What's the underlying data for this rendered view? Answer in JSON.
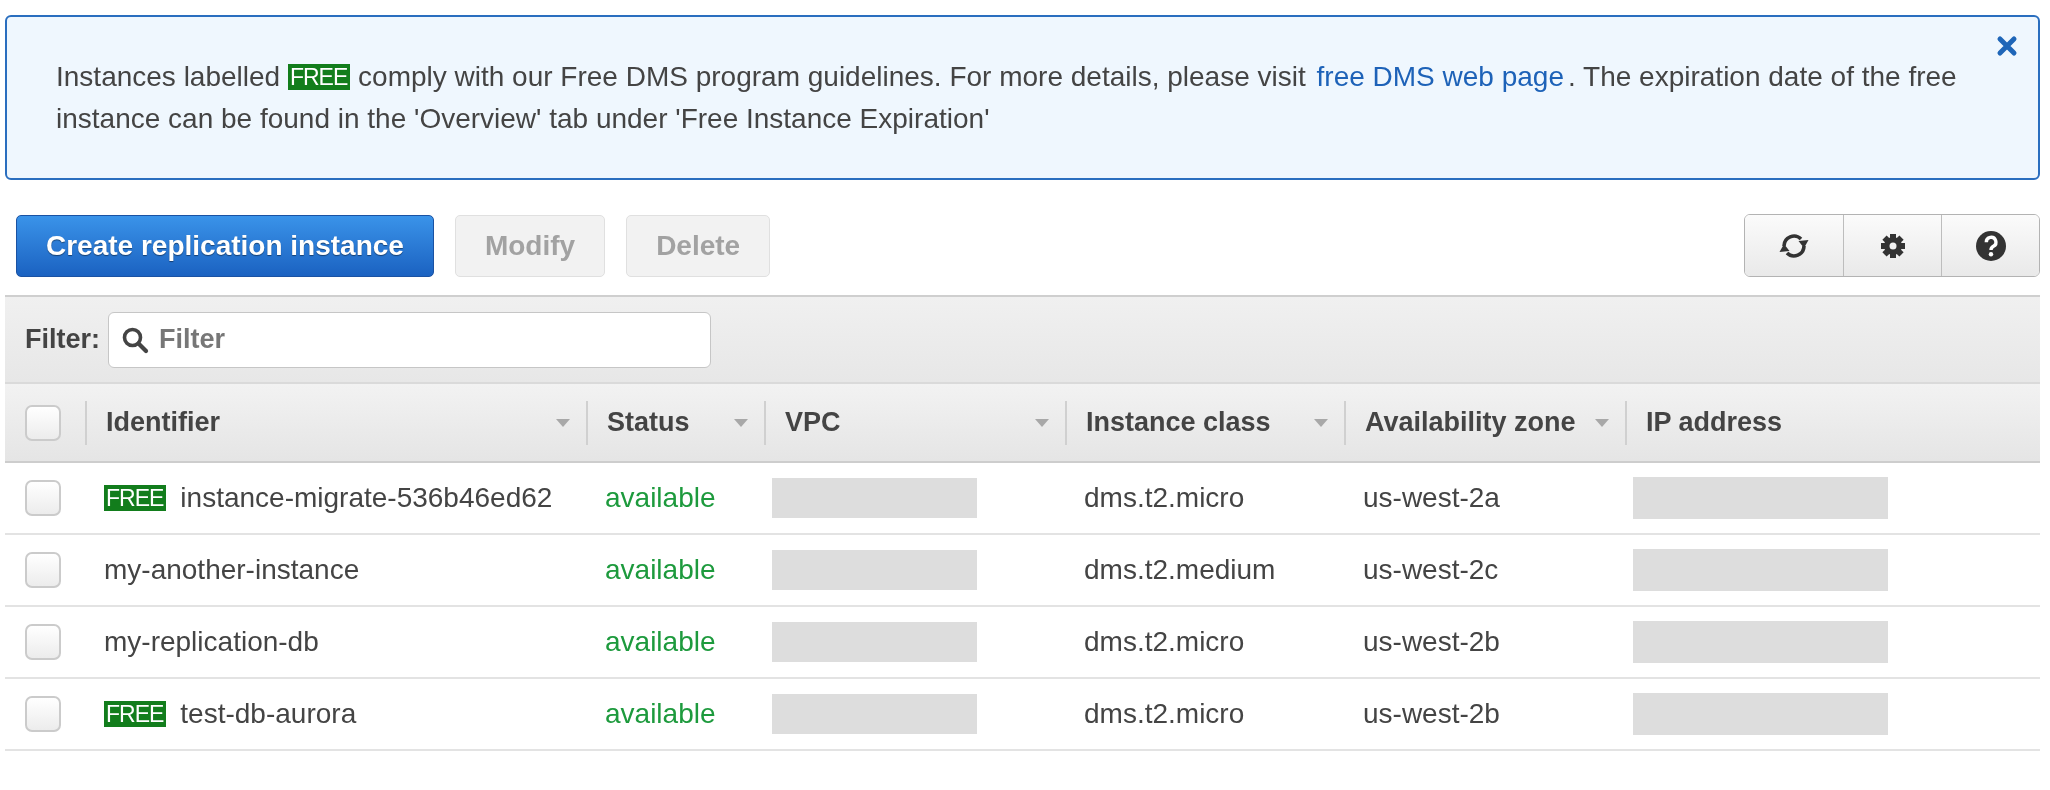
{
  "notice": {
    "dismissible": true,
    "parts": [
      {
        "kind": "text",
        "text": "Instances labelled "
      },
      {
        "kind": "badge",
        "text": "FREE"
      },
      {
        "kind": "text",
        "text": " comply with our Free DMS program guidelines. For more details, please visit "
      },
      {
        "kind": "link",
        "text": "free DMS web page"
      },
      {
        "kind": "text",
        "text": ". The expiration date of the free instance can be found in the 'Overview' tab under 'Free Instance Expiration'"
      }
    ]
  },
  "toolbar": {
    "buttons": [
      {
        "label": "Create replication instance",
        "kind": "primary",
        "disabled": false
      },
      {
        "label": "Modify",
        "kind": "secondary",
        "disabled": true
      },
      {
        "label": "Delete",
        "kind": "secondary",
        "disabled": true
      }
    ],
    "tools": [
      {
        "kind": "refresh"
      },
      {
        "kind": "settings"
      },
      {
        "kind": "help"
      }
    ]
  },
  "filter": {
    "label": "Filter:",
    "placeholder": "Filter"
  },
  "table": {
    "select_all": {
      "checked": false
    },
    "columns": [
      {
        "label": "Identifier",
        "sortable": true
      },
      {
        "label": "Status",
        "sortable": true
      },
      {
        "label": "VPC",
        "sortable": true
      },
      {
        "label": "Instance class",
        "sortable": true
      },
      {
        "label": "Availability zone",
        "sortable": true
      },
      {
        "label": "IP address",
        "sortable": false
      }
    ],
    "rows": [
      {
        "checked": false,
        "badge": "FREE",
        "identifier": "instance-migrate-536b46ed62",
        "status": "available",
        "vpc": {
          "redacted": true
        },
        "instance_class": "dms.t2.micro",
        "availability_zone": "us-west-2a",
        "ip_address": {
          "redacted": true
        }
      },
      {
        "checked": false,
        "identifier": "my-another-instance",
        "status": "available",
        "vpc": {
          "redacted": true
        },
        "instance_class": "dms.t2.medium",
        "availability_zone": "us-west-2c",
        "ip_address": {
          "redacted": true
        }
      },
      {
        "checked": false,
        "identifier": "my-replication-db",
        "status": "available",
        "vpc": {
          "redacted": true
        },
        "instance_class": "dms.t2.micro",
        "availability_zone": "us-west-2b",
        "ip_address": {
          "redacted": true
        }
      },
      {
        "checked": false,
        "badge": "FREE",
        "identifier": "test-db-aurora",
        "status": "available",
        "vpc": {
          "redacted": true
        },
        "instance_class": "dms.t2.micro",
        "availability_zone": "us-west-2b",
        "ip_address": {
          "redacted": true
        }
      }
    ]
  }
}
